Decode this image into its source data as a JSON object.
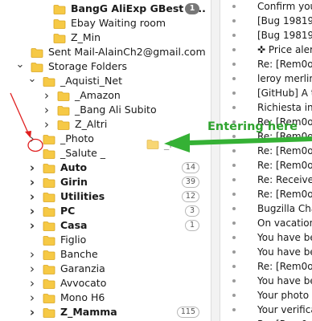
{
  "folders": [
    {
      "label": "BangG AliExp GBest S...",
      "bold": true,
      "badge": "1",
      "badge_dark": true
    },
    {
      "label": "Ebay Waiting room",
      "bold": false
    },
    {
      "label": "Z_Min",
      "bold": false
    },
    {
      "label": "Sent Mail-AlainCh2@gmail.com",
      "bold": false
    },
    {
      "label": "Storage Folders",
      "bold": false
    },
    {
      "label": "_Aquisti_Net",
      "bold": false
    },
    {
      "label": "_Amazon",
      "bold": false
    },
    {
      "label": "_Bang Ali Subito",
      "bold": false
    },
    {
      "label": "Z_Altri",
      "bold": false
    },
    {
      "label": "_Photo",
      "bold": false
    },
    {
      "label": "_Salute _",
      "bold": false
    },
    {
      "label": "Auto",
      "bold": true,
      "badge": "14"
    },
    {
      "label": "Girin",
      "bold": true,
      "badge": "39"
    },
    {
      "label": "Utilities",
      "bold": true,
      "badge": "12"
    },
    {
      "label": "PC",
      "bold": true,
      "badge": "3"
    },
    {
      "label": "Casa",
      "bold": true,
      "badge": "1"
    },
    {
      "label": "Figlio",
      "bold": false
    },
    {
      "label": "Banche",
      "bold": false
    },
    {
      "label": "Garanzia",
      "bold": false
    },
    {
      "label": "Avvocato",
      "bold": false
    },
    {
      "label": "Mono H6",
      "bold": false
    },
    {
      "label": "Z_Mamma",
      "bold": true,
      "badge": "115"
    }
  ],
  "drag_ghost_label": "_Ph",
  "messages": [
    "Confirm you",
    "[Bug 198199",
    "[Bug 198199",
    "✜ Price alert",
    "Re: [Rem0o/",
    "leroy merlin",
    "[GitHub] A th",
    "Richiesta info",
    "Re: [Rem0o/",
    "Re: [Rem0o/",
    "Re: [Rem0o/",
    "Re: [Rem0o/",
    "Re: Received",
    "Re: [Rem0o/",
    "Bugzilla Char",
    "On vacation",
    "You have bee",
    "You have bee",
    "Re: [Rem0o/",
    "You have bee",
    "Your photo r",
    "Your verificat",
    "Re: [Rem0o/"
  ],
  "annotation": "Entering here",
  "colors": {
    "folder_yellow": "#f6c945",
    "folder_edge": "#d9a520",
    "annotation_green": "#35b135",
    "red_arrow": "#e02020"
  }
}
